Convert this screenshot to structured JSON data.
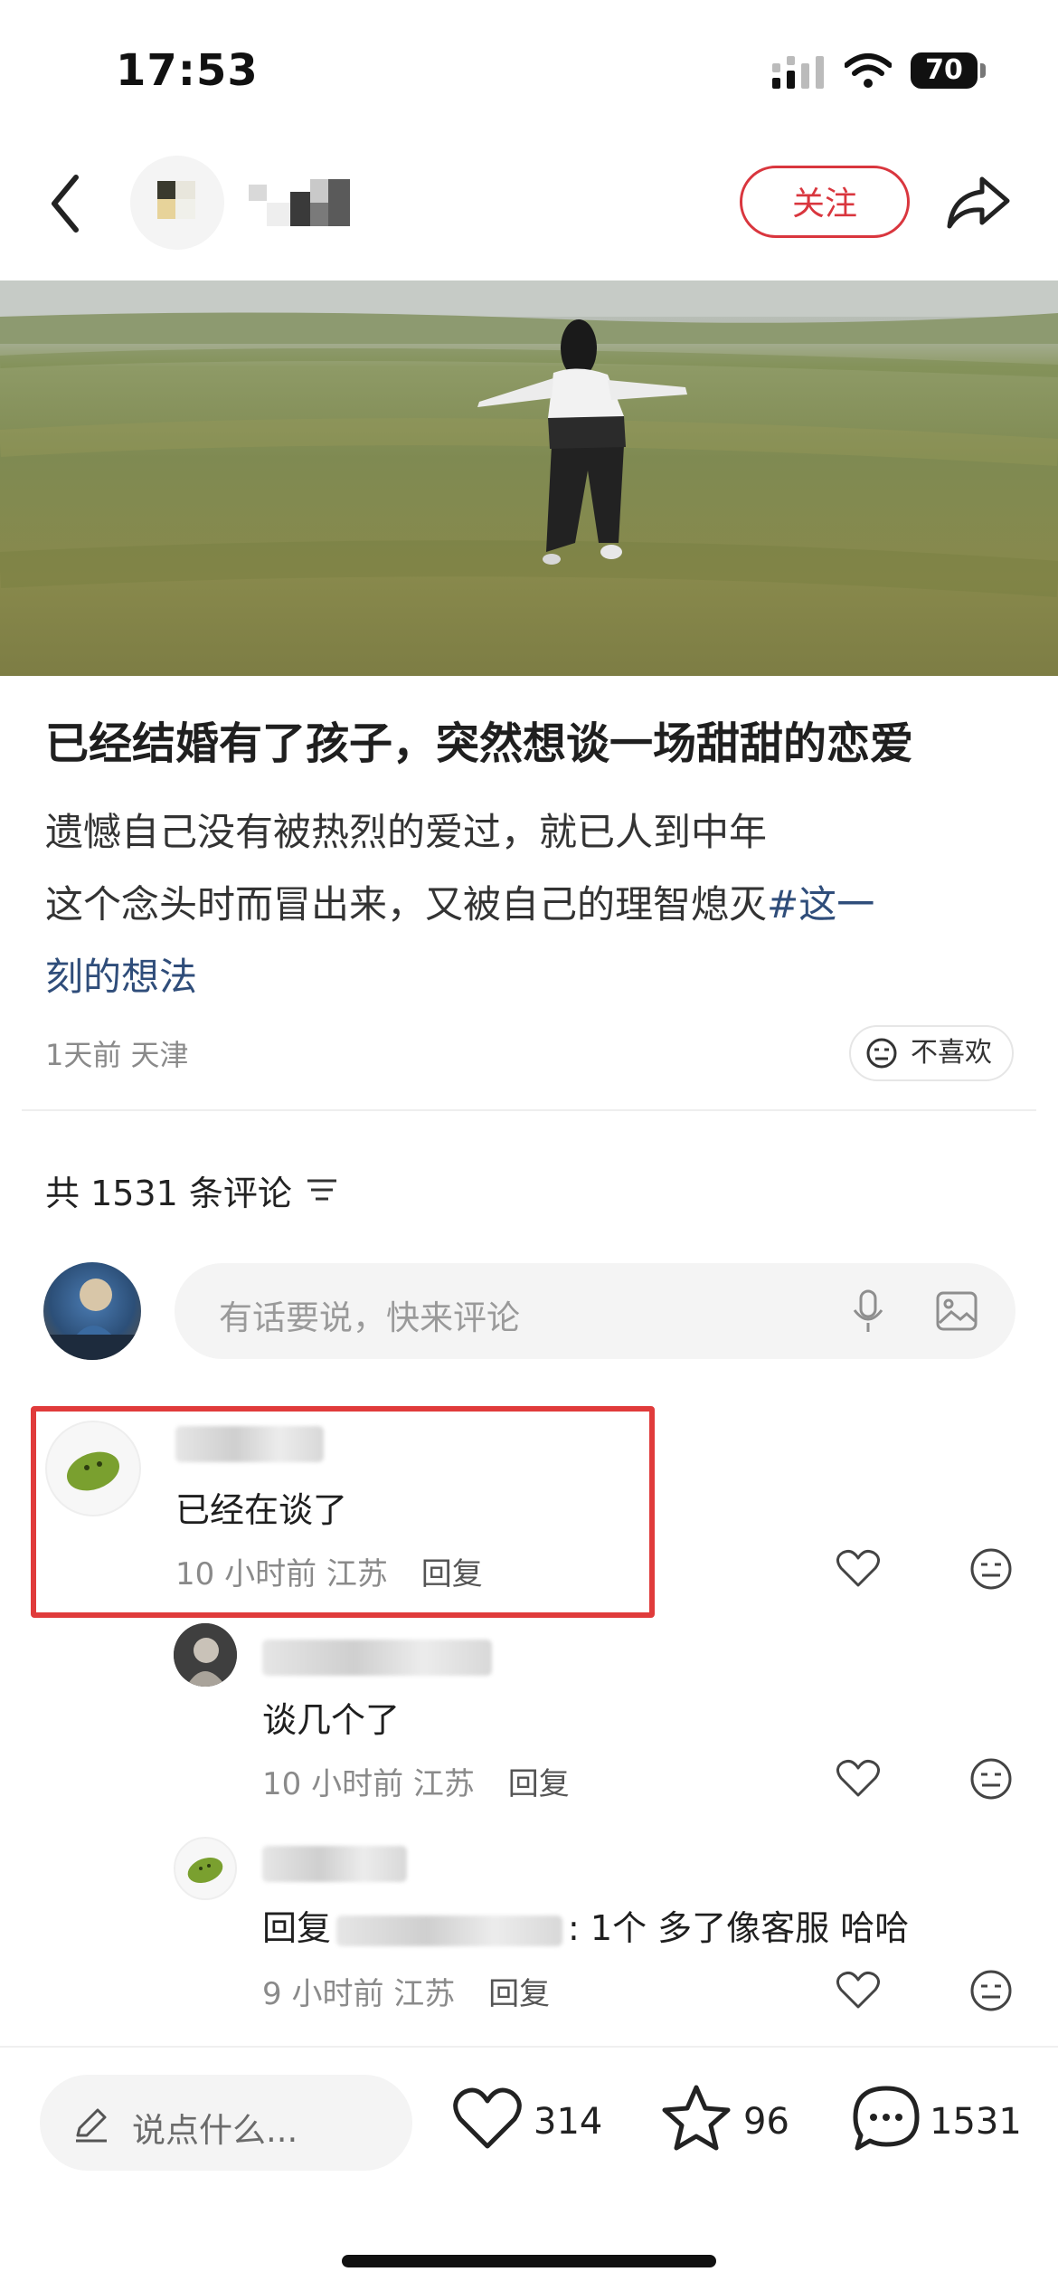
{
  "status_bar": {
    "time": "17:53",
    "battery": "70"
  },
  "header": {
    "follow_label": "关注",
    "accent_color": "#d9363e"
  },
  "post": {
    "title": "已经结婚有了孩子，突然想谈一场甜甜的恋爱",
    "body_line1": "遗憾自己没有被热烈的爱过，就已人到中年",
    "body_line2_prefix": "这个念头时而冒出来，又被自己的理智熄灭",
    "hashtag_part1": "#这一",
    "hashtag_part2": "刻的想法",
    "time": "1天前",
    "location": "天津",
    "dislike_label": "不喜欢"
  },
  "comments_header": {
    "label": "共 1531 条评论"
  },
  "comment_input": {
    "placeholder": "有话要说，快来评论"
  },
  "comments": [
    {
      "text": "已经在谈了",
      "time": "10 小时前",
      "location": "江苏",
      "reply_label": "回复"
    },
    {
      "text": "谈几个了",
      "time": "10 小时前",
      "location": "江苏",
      "reply_label": "回复"
    },
    {
      "text_prefix": "回复",
      "text_suffix": ": 1个 多了像客服 哈哈",
      "time": "9 小时前",
      "location": "江苏",
      "reply_label": "回复"
    }
  ],
  "bottom_bar": {
    "say_placeholder": "说点什么...",
    "likes": "314",
    "stars": "96",
    "comments": "1531"
  }
}
